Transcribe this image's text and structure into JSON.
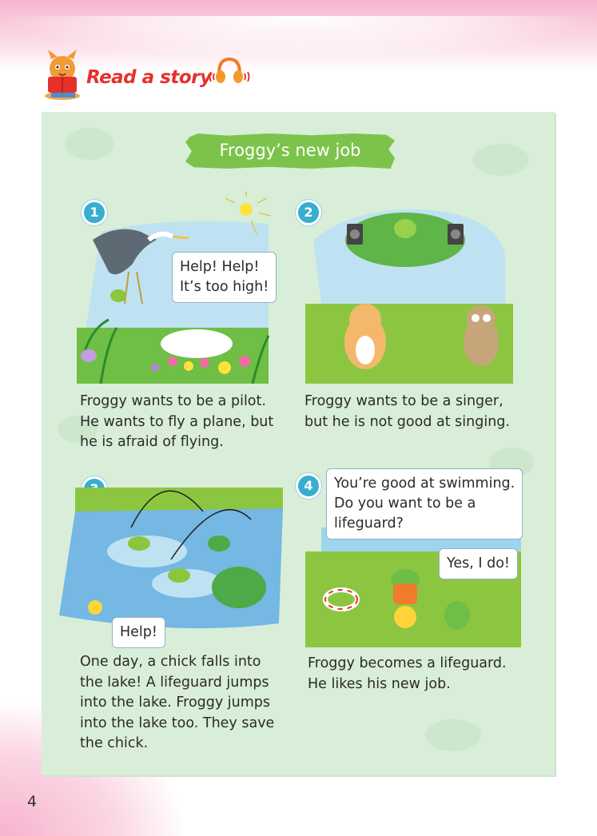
{
  "header": {
    "title": "Read a story"
  },
  "story": {
    "title": "Froggy’s new job",
    "panels": [
      {
        "number": "1",
        "bubbles": [
          "Help! Help!",
          "It’s too high!"
        ],
        "caption": [
          "Froggy wants to be a pilot.",
          "He wants to fly a plane, but",
          "he is afraid of flying."
        ]
      },
      {
        "number": "2",
        "bubbles": [],
        "caption": [
          "Froggy wants to be a singer,",
          "but he is not good at singing."
        ]
      },
      {
        "number": "3",
        "bubbles": [
          "Help!"
        ],
        "caption": [
          "One day, a chick falls into",
          "the lake! A lifeguard jumps",
          "into the lake. Froggy jumps",
          "into the lake too. They save",
          "the chick."
        ]
      },
      {
        "number": "4",
        "bubbles": [
          "You’re good at swimming.",
          "Do you want to be a",
          "lifeguard?",
          "Yes, I do!"
        ],
        "caption": [
          "Froggy becomes a lifeguard.",
          "He likes his new job."
        ]
      }
    ]
  },
  "page_number": "4",
  "colors": {
    "accent_red": "#e5312c",
    "banner_green": "#7cc34b",
    "panel_green": "#d9eed8",
    "number_blue": "#39aecf",
    "page_pink": "#f6b6cf"
  }
}
